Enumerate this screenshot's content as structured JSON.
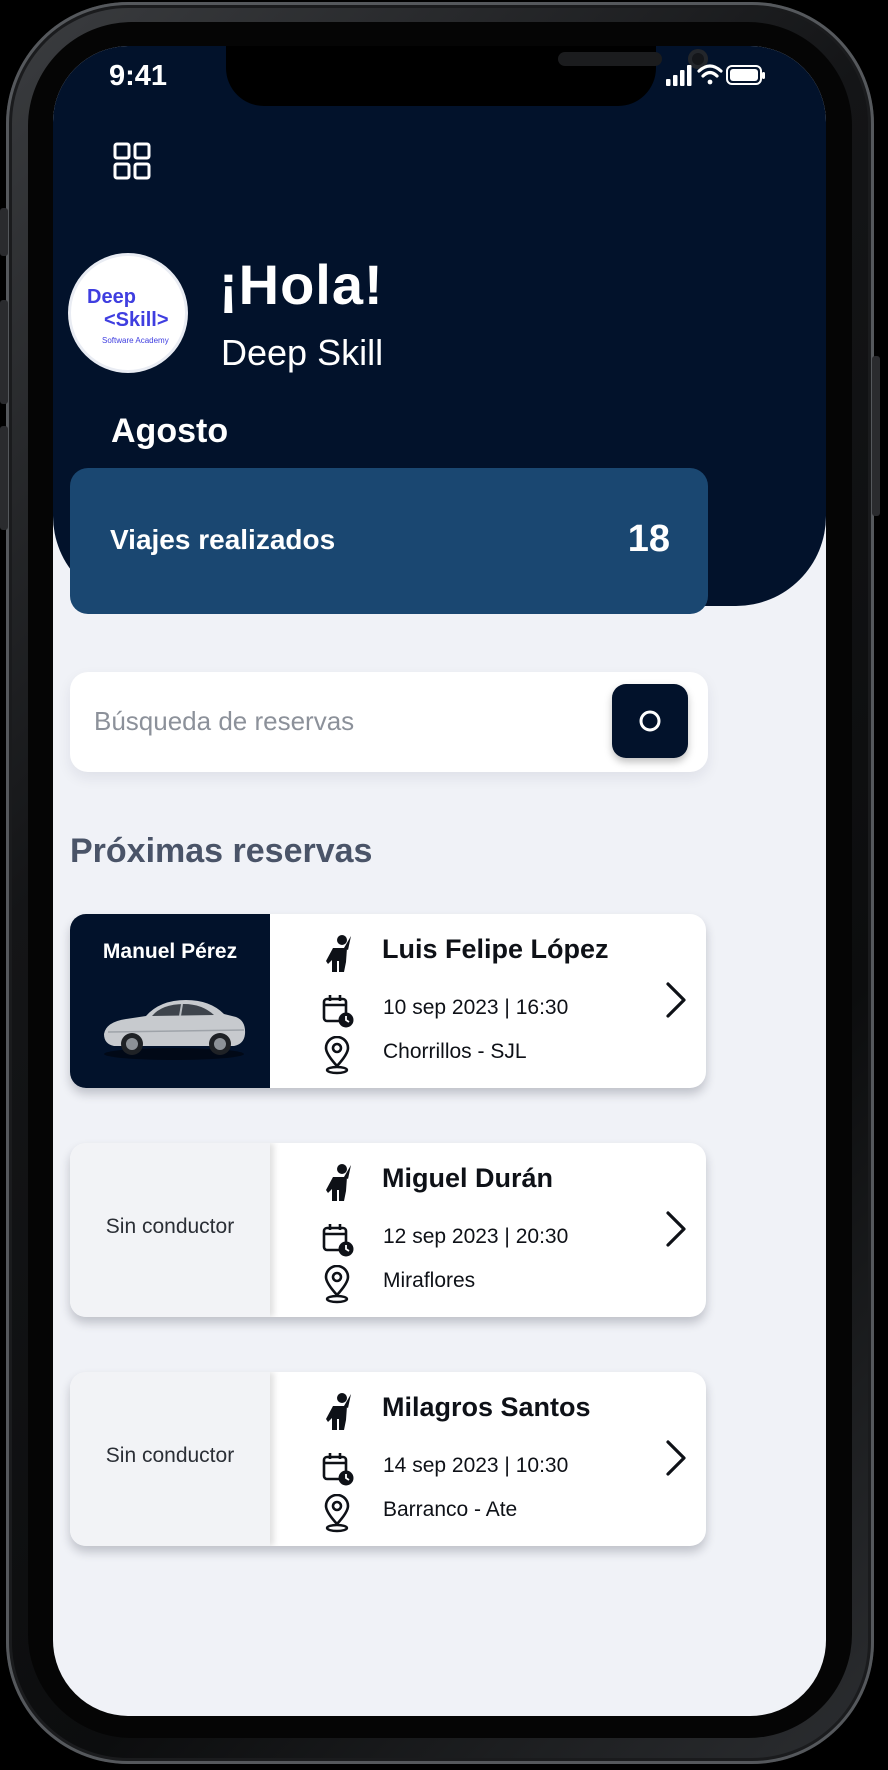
{
  "status_bar": {
    "time": "9:41"
  },
  "header": {
    "menu_icon": "grid-icon",
    "avatar": {
      "line1": "Deep",
      "line2": "<Skill>",
      "line3": "Software Academy"
    },
    "greeting": "¡Hola!",
    "user_name": "Deep Skill",
    "month": "Agosto"
  },
  "stats": {
    "label": "Viajes realizados",
    "value": "18"
  },
  "search": {
    "placeholder": "Búsqueda de reservas",
    "button_icon": "search-circle-icon"
  },
  "section_title": "Próximas reservas",
  "reservations": [
    {
      "driver": "Manuel Pérez",
      "has_driver": true,
      "passenger": "Luis Felipe López",
      "datetime": "10 sep 2023 | 16:30",
      "location": "Chorrillos - SJL"
    },
    {
      "driver": "Sin conductor",
      "has_driver": false,
      "passenger": "Miguel Durán",
      "datetime": "12 sep 2023 | 20:30",
      "location": "Miraflores"
    },
    {
      "driver": "Sin conductor",
      "has_driver": false,
      "passenger": "Milagros Santos",
      "datetime": "14 sep 2023 | 10:30",
      "location": "Barranco - Ate"
    }
  ],
  "colors": {
    "header_bg": "#02122b",
    "stats_card": "#1a4771",
    "page_bg": "#f0f2f7",
    "logo": "#3f3ee0"
  }
}
